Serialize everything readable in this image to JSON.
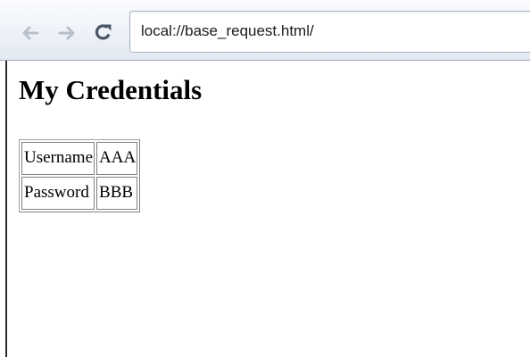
{
  "browser": {
    "url": "local://base_request.html/",
    "icons": {
      "back": "arrow-left-icon",
      "forward": "arrow-right-icon",
      "reload": "reload-icon"
    },
    "colors": {
      "nav_icon_disabled": "#b8bfca",
      "reload_icon": "#4a5566"
    }
  },
  "page": {
    "title": "My Credentials",
    "credentials": [
      {
        "label": "Username",
        "value": "AAA"
      },
      {
        "label": "Password",
        "value": "BBB"
      }
    ]
  }
}
